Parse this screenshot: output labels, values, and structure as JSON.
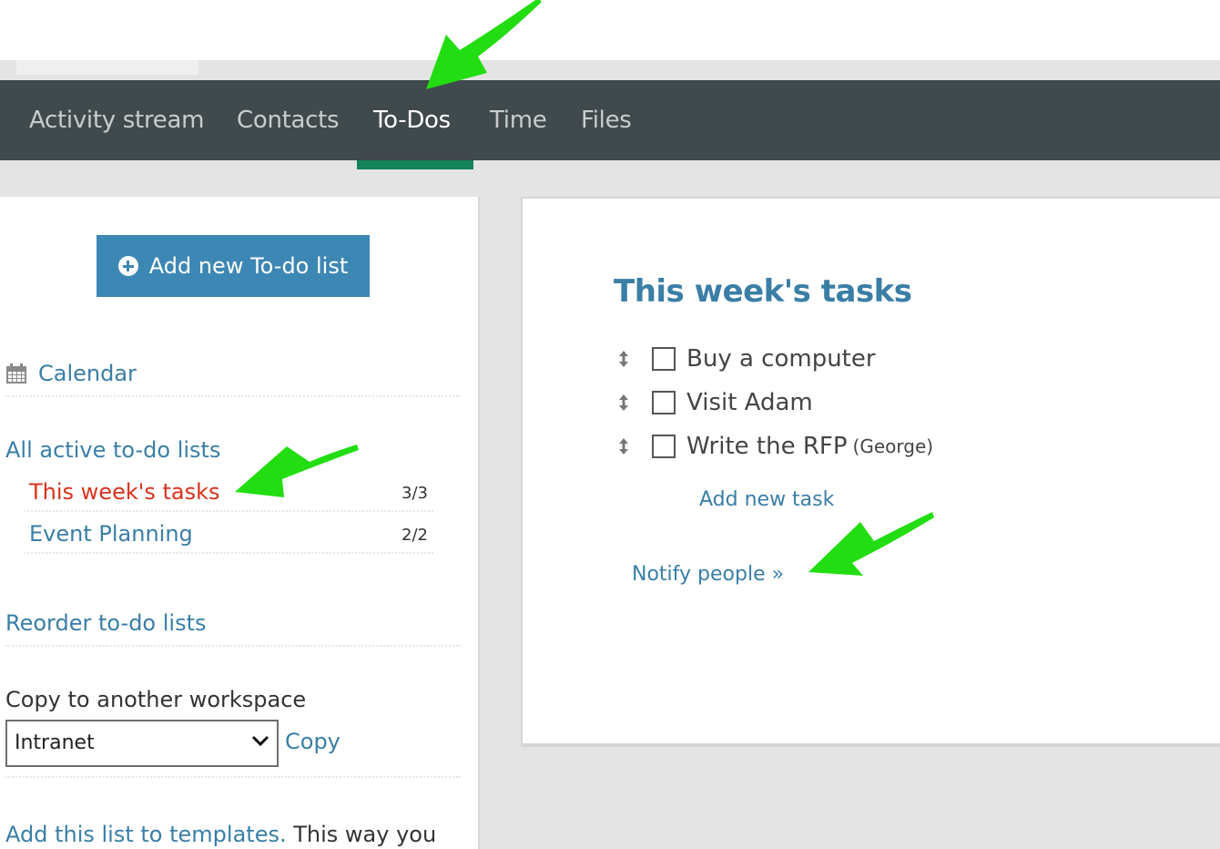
{
  "nav": {
    "items": [
      {
        "label": "Activity stream",
        "active": false
      },
      {
        "label": "Contacts",
        "active": false
      },
      {
        "label": "To-Dos",
        "active": true
      },
      {
        "label": "Time",
        "active": false
      },
      {
        "label": "Files",
        "active": false
      }
    ]
  },
  "sidebar": {
    "add_list_label": "Add new To-do list",
    "add_list_icon": "plus-circle-icon",
    "calendar_icon": "calendar-icon",
    "calendar_label": "Calendar",
    "all_lists_label": "All active to-do lists",
    "lists": [
      {
        "name": "This week's tasks",
        "count": "3/3",
        "active": true
      },
      {
        "name": "Event Planning",
        "count": "2/2",
        "active": false
      }
    ],
    "reorder_label": "Reorder to-do lists",
    "copy_label": "Copy to another workspace",
    "workspace_select_value": "Intranet",
    "copy_button_label": "Copy",
    "templates_link": "Add this list to templates.",
    "templates_text": " This way you"
  },
  "main": {
    "title": "This week's tasks",
    "tasks": [
      {
        "text": "Buy a computer",
        "assignee": "",
        "done": false
      },
      {
        "text": "Visit Adam",
        "assignee": "",
        "done": false
      },
      {
        "text": "Write the RFP",
        "assignee": "(George)",
        "done": false
      }
    ],
    "add_task_label": "Add new task",
    "notify_label": "Notify people »"
  },
  "colors": {
    "nav_bg": "#40494c",
    "nav_active_underline": "#13835a",
    "primary_button": "#3d87b5",
    "link": "#3a7ea6",
    "active_list": "#d8321c",
    "annotation_arrow": "#22dd11"
  }
}
